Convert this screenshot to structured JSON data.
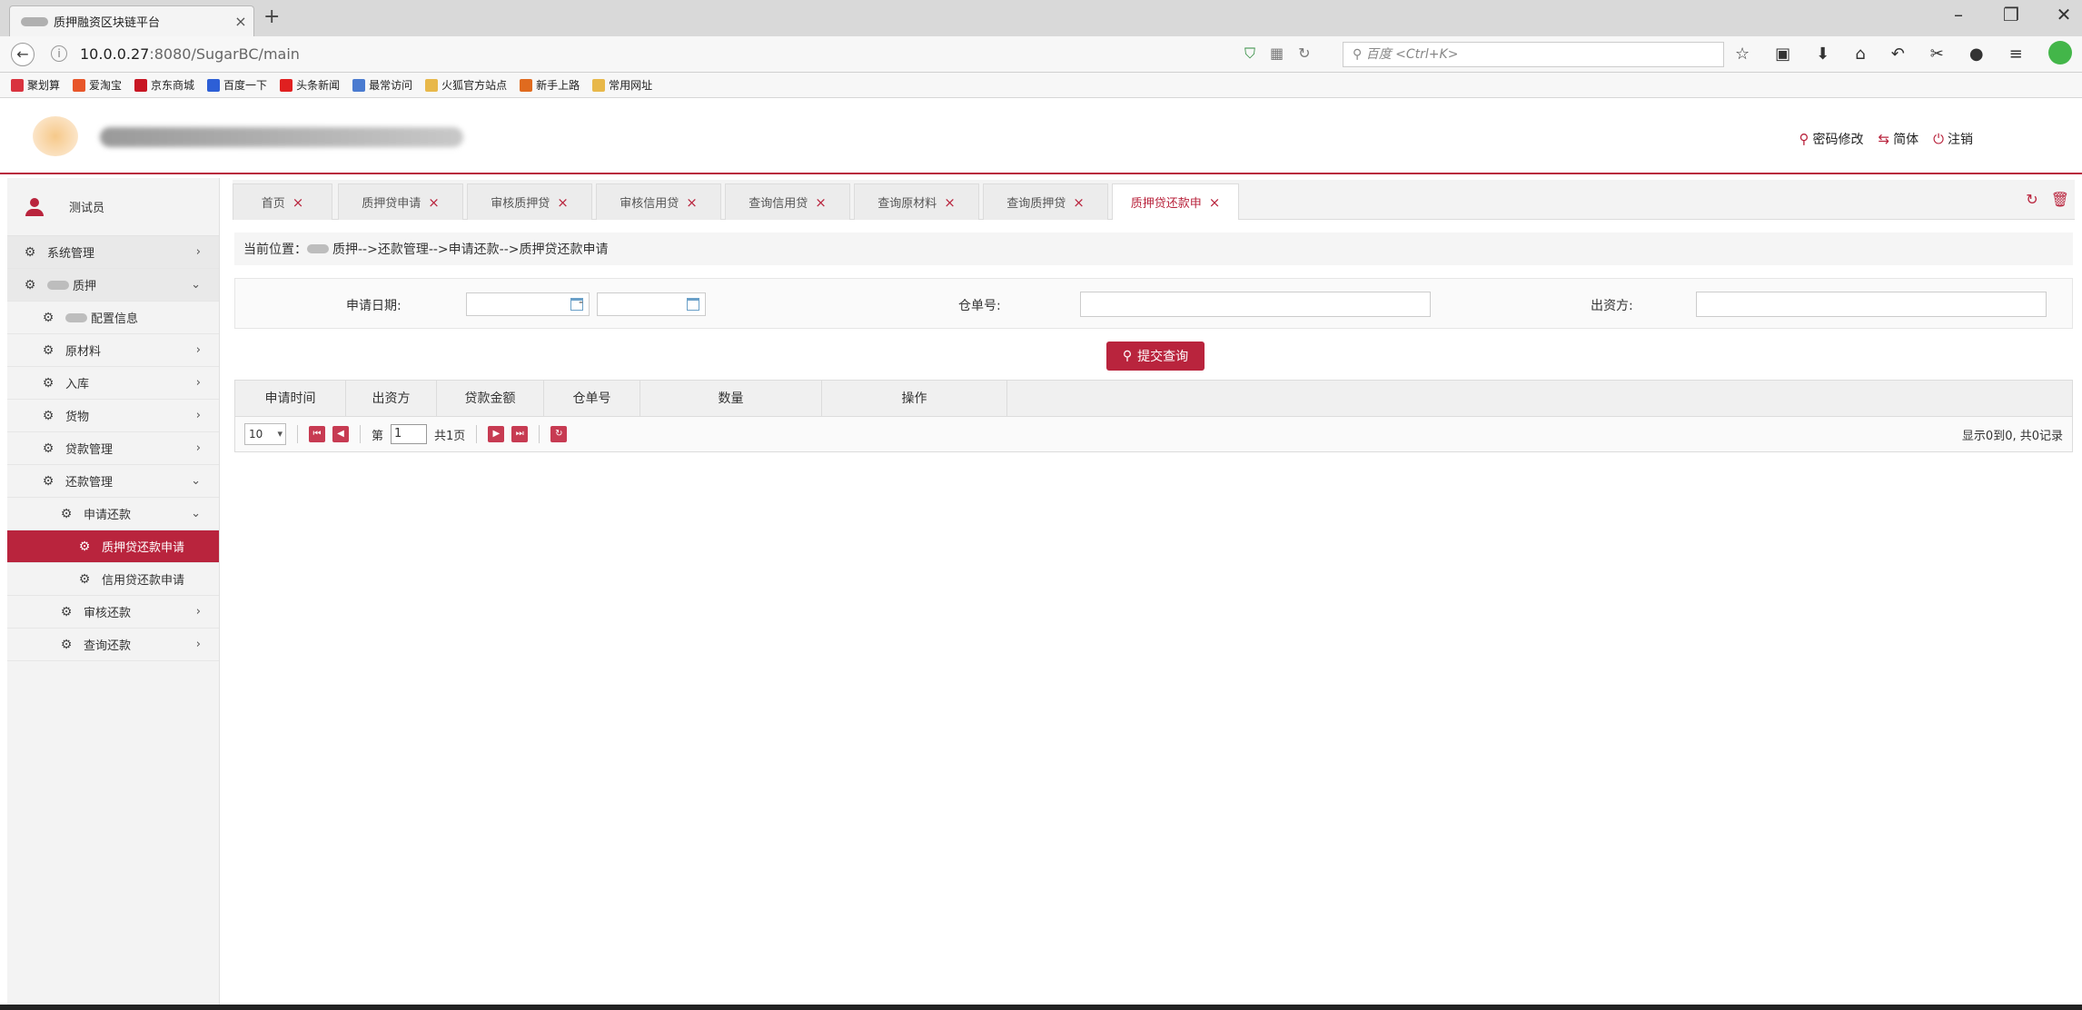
{
  "browser": {
    "tab_title": "质押融资区块链平台",
    "tab_close": "×",
    "new_tab": "+",
    "url_host": "10.0.0.27",
    "url_rest": ":8080/SugarBC/main",
    "search_placeholder": "百度 <Ctrl+K>",
    "window_controls": [
      "–",
      "❐",
      "✕"
    ]
  },
  "bookmarks": [
    {
      "label": "聚划算",
      "color": "#d9333f"
    },
    {
      "label": "爱淘宝",
      "color": "#e8562a"
    },
    {
      "label": "京东商城",
      "color": "#c81623"
    },
    {
      "label": "百度一下",
      "color": "#2d5fd6"
    },
    {
      "label": "头条新闻",
      "color": "#e02020"
    },
    {
      "label": "最常访问",
      "color": "#4a7bd0"
    },
    {
      "label": "火狐官方站点",
      "color": "#e8b84a"
    },
    {
      "label": "新手上路",
      "color": "#e06b1f"
    },
    {
      "label": "常用网址",
      "color": "#e8b84a"
    }
  ],
  "header": {
    "links": [
      {
        "icon": "⚲",
        "label": "密码修改"
      },
      {
        "icon": "⇆",
        "label": "简体"
      },
      {
        "icon": "⏻",
        "label": "注销"
      }
    ]
  },
  "sidebar": {
    "user": "测试员",
    "items": [
      {
        "label": "系统管理",
        "level": 0,
        "arrow": "›",
        "active": false
      },
      {
        "label": "质押",
        "level": 0,
        "arrow": "⌄",
        "active": false,
        "blur": true
      },
      {
        "label": "配置信息",
        "level": 1,
        "arrow": "",
        "active": false,
        "blur": true
      },
      {
        "label": "原材料",
        "level": 1,
        "arrow": "›",
        "active": false
      },
      {
        "label": "入库",
        "level": 1,
        "arrow": "›",
        "active": false
      },
      {
        "label": "货物",
        "level": 1,
        "arrow": "›",
        "active": false
      },
      {
        "label": "贷款管理",
        "level": 1,
        "arrow": "›",
        "active": false
      },
      {
        "label": "还款管理",
        "level": 1,
        "arrow": "⌄",
        "active": false
      },
      {
        "label": "申请还款",
        "level": 2,
        "arrow": "⌄",
        "active": false
      },
      {
        "label": "质押贷还款申请",
        "level": 3,
        "arrow": "",
        "active": true
      },
      {
        "label": "信用贷还款申请",
        "level": 3,
        "arrow": "",
        "active": false
      },
      {
        "label": "审核还款",
        "level": 2,
        "arrow": "›",
        "active": false
      },
      {
        "label": "查询还款",
        "level": 2,
        "arrow": "›",
        "active": false
      }
    ]
  },
  "tabs": [
    {
      "label": "首页",
      "close": "×",
      "active": false
    },
    {
      "label": "质押贷申请",
      "close": "×",
      "active": false
    },
    {
      "label": "审核质押贷",
      "close": "×",
      "active": false
    },
    {
      "label": "审核信用贷",
      "close": "×",
      "active": false
    },
    {
      "label": "查询信用贷",
      "close": "×",
      "active": false
    },
    {
      "label": "查询原材料",
      "close": "×",
      "active": false
    },
    {
      "label": "查询质押贷",
      "close": "×",
      "active": false
    },
    {
      "label": "质押贷还款申",
      "close": "×",
      "active": true
    }
  ],
  "tab_tools": {
    "refresh": "↻",
    "delete": "🗑"
  },
  "breadcrumb": {
    "prefix": "当前位置：",
    "path": "质押-->还款管理-->申请还款-->质押贷还款申请"
  },
  "filter": {
    "date_label": "申请日期:",
    "date_sep": "-",
    "warehouse_label": "仓单号:",
    "lender_label": "出资方:"
  },
  "query_button": "提交查询",
  "table": {
    "columns": [
      "申请时间",
      "出资方",
      "贷款金额",
      "仓单号",
      "数量",
      "操作"
    ]
  },
  "pager": {
    "page_size": "10",
    "page_prefix": "第",
    "page_value": "1",
    "page_suffix": "共1页",
    "info": "显示0到0, 共0记录"
  }
}
